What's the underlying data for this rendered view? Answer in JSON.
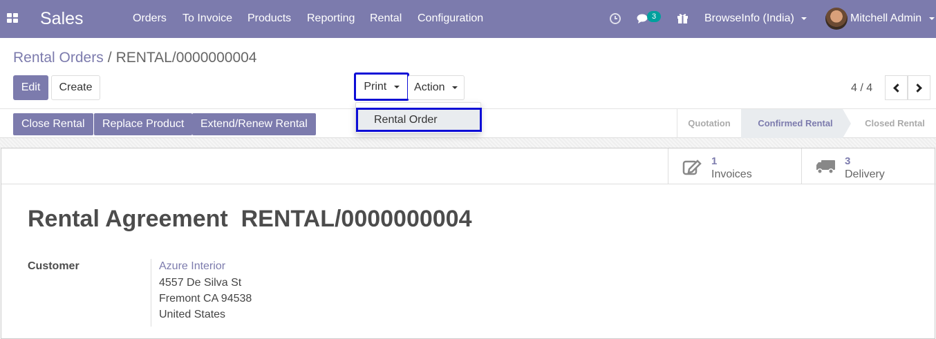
{
  "navbar": {
    "brand": "Sales",
    "menu": [
      "Orders",
      "To Invoice",
      "Products",
      "Reporting",
      "Rental",
      "Configuration"
    ],
    "messages_count": "3",
    "company": "BrowseInfo (India)",
    "user": "Mitchell Admin"
  },
  "breadcrumb": {
    "parent": "Rental Orders",
    "separator": "/",
    "current": "RENTAL/0000000004"
  },
  "toolbar": {
    "edit": "Edit",
    "create": "Create",
    "print": "Print",
    "action": "Action",
    "pager": "4 / 4"
  },
  "print_menu": {
    "items": [
      "Rental Order"
    ]
  },
  "statusbar": {
    "buttons": [
      "Close Rental",
      "Replace Product",
      "Extend/Renew Rental"
    ],
    "stages": [
      "Quotation",
      "Confirmed Rental",
      "Closed Rental"
    ],
    "active_stage": "Confirmed Rental"
  },
  "smart_buttons": [
    {
      "count": "1",
      "label": "Invoices",
      "icon": "pencil-square-icon"
    },
    {
      "count": "3",
      "label": "Delivery",
      "icon": "truck-icon"
    }
  ],
  "form": {
    "title_prefix": "Rental Agreement",
    "title_number": "RENTAL/0000000004",
    "customer_label": "Customer",
    "customer_name": "Azure Interior",
    "address_lines": [
      "4557 De Silva St",
      "Fremont CA 94538",
      "United States"
    ]
  },
  "colors": {
    "brand": "#7c7bad",
    "highlight_border": "#0d0dd6",
    "badge": "#00a09d"
  }
}
